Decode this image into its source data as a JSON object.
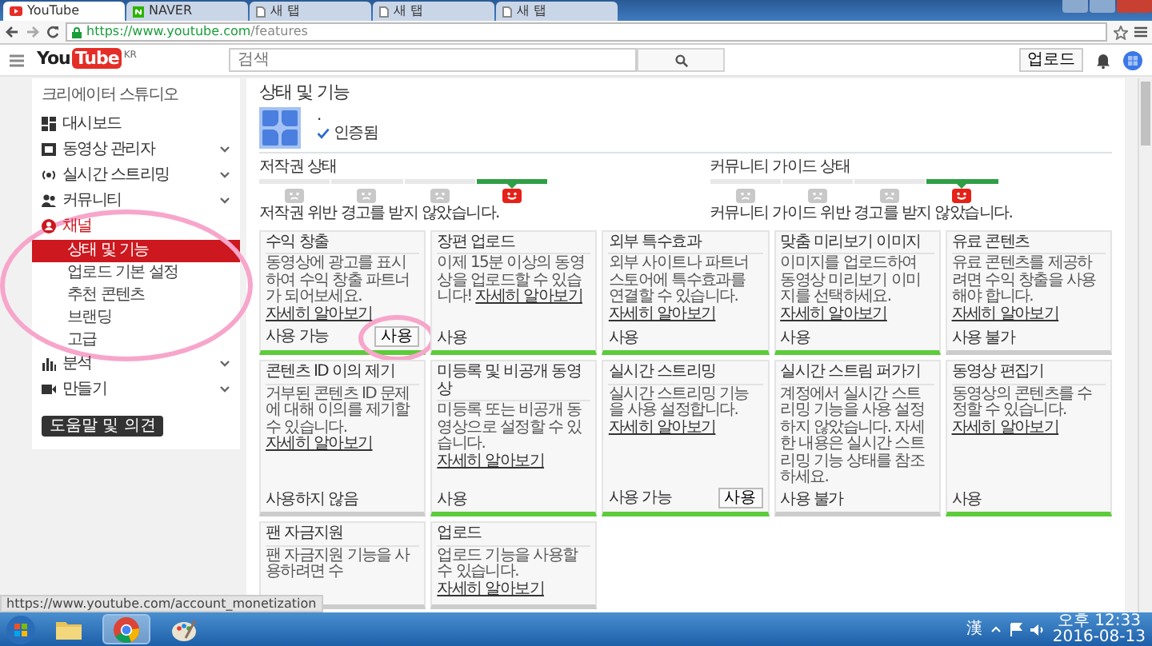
{
  "browser": {
    "tabs": [
      {
        "label": "YouTube",
        "selected": true
      },
      {
        "label": "NAVER",
        "selected": false
      },
      {
        "label": "새 탭",
        "selected": false
      },
      {
        "label": "새 탭",
        "selected": false
      },
      {
        "label": "새 탭",
        "selected": false
      }
    ],
    "address": {
      "host": "https://www.youtube.com",
      "path": "/features"
    }
  },
  "header": {
    "logo": {
      "you": "You",
      "tube": "Tube",
      "region": "KR"
    },
    "search": {
      "placeholder": "검색"
    },
    "upload_button": "업로드"
  },
  "sidebar": {
    "title": "크리에이터 스튜디오",
    "circled": true,
    "items": [
      {
        "label": "대시보드",
        "kind": "dashboard",
        "expandable": false,
        "selected": false
      },
      {
        "label": "동영상 관리자",
        "kind": "video",
        "expandable": true,
        "selected": false
      },
      {
        "label": "실시간 스트리밍",
        "kind": "live",
        "expandable": true,
        "selected": false
      },
      {
        "label": "커뮤니티",
        "kind": "community",
        "expandable": true,
        "selected": false
      },
      {
        "label": "채널",
        "kind": "channel",
        "expandable": false,
        "selected": true,
        "children": [
          {
            "label": "상태 및 기능",
            "selected": true
          },
          {
            "label": "업로드 기본 설정",
            "selected": false
          },
          {
            "label": "추천 콘텐츠",
            "selected": false
          },
          {
            "label": "브랜딩",
            "selected": false
          },
          {
            "label": "고급",
            "selected": false
          }
        ]
      },
      {
        "label": "분석",
        "kind": "analytics",
        "expandable": true,
        "selected": false
      },
      {
        "label": "만들기",
        "kind": "create",
        "expandable": true,
        "selected": false
      }
    ],
    "help_button": "도움말 및 의견"
  },
  "page": {
    "title": "상태 및 기능",
    "channel_name": ".",
    "verified": "인증됨",
    "status_sections": [
      {
        "title": "저작권 상태",
        "segments": [
          {
            "selected": false
          },
          {
            "selected": false
          },
          {
            "selected": false
          },
          {
            "selected": true
          }
        ],
        "message": "저작권 위반 경고를 받지 않았습니다."
      },
      {
        "title": "커뮤니티 가이드 상태",
        "segments": [
          {
            "selected": false
          },
          {
            "selected": false
          },
          {
            "selected": false
          },
          {
            "selected": true
          }
        ],
        "message": "커뮤니티 가이드 위반 경고를 받지 않았습니다."
      }
    ],
    "features": [
      {
        "title": "수익 창출",
        "description": "동영상에 광고를 표시하여 수익 창출 파트너가 되어보세요. ",
        "link": "자세히 알아보기",
        "status": "사용 가능",
        "enabled": true,
        "action": "사용",
        "circled": true
      },
      {
        "title": "장편 업로드",
        "description": "이제 15분 이상의 동영상을 업로드할 수 있습니다! ",
        "link": "자세히 알아보기",
        "status": "사용",
        "enabled": true
      },
      {
        "title": "외부 특수효과",
        "description": "외부 사이트나 파트너 스토어에 특수효과를 연결할 수 있습니다. ",
        "link": "자세히 알아보기",
        "status": "사용",
        "enabled": true
      },
      {
        "title": "맞춤 미리보기 이미지",
        "description": "이미지를 업로드하여 동영상 미리보기 이미지를 선택하세요. ",
        "link": "자세히 알아보기",
        "status": "사용",
        "enabled": true
      },
      {
        "title": "유료 콘텐츠",
        "description": "유료 콘텐츠를 제공하려면 수익 창출을 사용해야 합니다. ",
        "link": "자세히 알아보기",
        "status": "사용 불가",
        "enabled": false
      },
      {
        "title": "콘텐츠 ID 이의 제기",
        "description": "거부된 콘텐츠 ID 문제에 대해 이의를 제기할 수 있습니다. ",
        "link": "자세히 알아보기",
        "status": "사용하지 않음",
        "enabled": false
      },
      {
        "title": "미등록 및 비공개 동영상",
        "description": "미등록 또는 비공개 동영상으로 설정할 수 있습니다. ",
        "link": "자세히 알아보기",
        "status": "사용",
        "enabled": true
      },
      {
        "title": "실시간 스트리밍",
        "description": "실시간 스트리밍 기능을 사용 설정합니다. ",
        "link": "자세히 알아보기",
        "status": "사용 가능",
        "enabled": true,
        "action": "사용"
      },
      {
        "title": "실시간 스트림 퍼가기",
        "description": "계정에서 실시간 스트리밍 기능을 사용 설정하지 않았습니다. 자세한 내용은 실시간 스트리밍 기능 상태를 참조하세요.",
        "status": "사용 불가",
        "enabled": false
      },
      {
        "title": "동영상 편집기",
        "description": "동영상의 콘텐츠를 수정할 수 있습니다. ",
        "link": "자세히 알아보기",
        "status": "사용",
        "enabled": true
      },
      {
        "title": "팬 자금지원",
        "description": "팬 자금지원 기능을 사용하려면 수"
      },
      {
        "title": "업로드",
        "description": "업로드 기능을 사용할 수 있습니다. ",
        "link": "자세히 알아보기"
      }
    ]
  },
  "status_url": "https://www.youtube.com/account_monetization",
  "taskbar": {
    "apps": [
      {
        "kind": "folder",
        "selected": false
      },
      {
        "kind": "chrome",
        "selected": true
      },
      {
        "kind": "paint",
        "selected": false
      }
    ],
    "ime": "漢",
    "time": "오후 12:33",
    "date": "2016-08-13"
  }
}
